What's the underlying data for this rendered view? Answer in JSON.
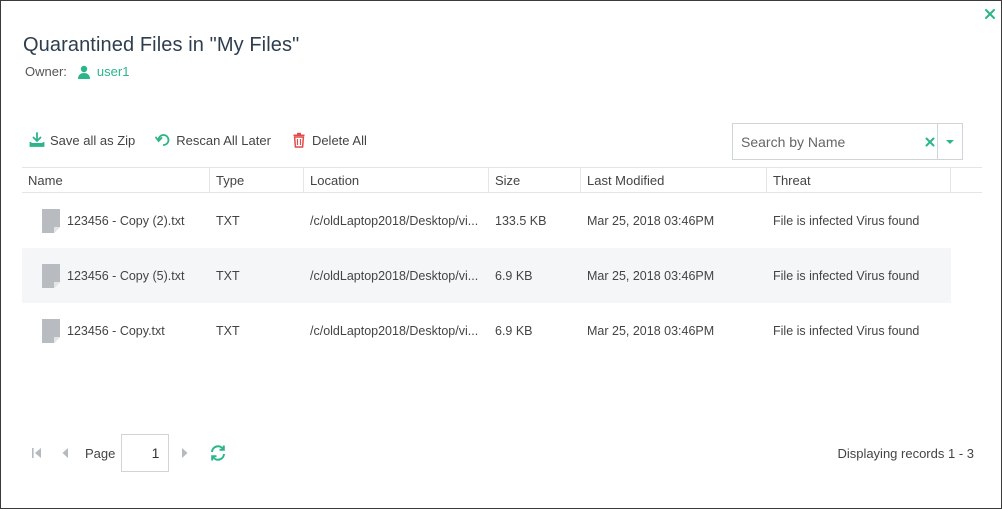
{
  "dialog": {
    "title": "Quarantined Files in \"My Files\"",
    "owner_label": "Owner:",
    "owner_name": "user1",
    "accent_color": "#2bb58a"
  },
  "toolbar": {
    "save_zip_label": "Save all as Zip",
    "rescan_label": "Rescan All Later",
    "delete_label": "Delete All"
  },
  "search": {
    "placeholder": "Search by Name",
    "value": ""
  },
  "table": {
    "columns": [
      "Name",
      "Type",
      "Location",
      "Size",
      "Last Modified",
      "Threat"
    ],
    "rows": [
      {
        "name": "123456 - Copy (2).txt",
        "type": "TXT",
        "location": "/c/oldLaptop2018/Desktop/vi...",
        "size": "133.5 KB",
        "modified": "Mar 25, 2018 03:46PM",
        "threat": "File is infected Virus found"
      },
      {
        "name": "123456 - Copy (5).txt",
        "type": "TXT",
        "location": "/c/oldLaptop2018/Desktop/vi...",
        "size": "6.9 KB",
        "modified": "Mar 25, 2018 03:46PM",
        "threat": "File is infected Virus found"
      },
      {
        "name": "123456 - Copy.txt",
        "type": "TXT",
        "location": "/c/oldLaptop2018/Desktop/vi...",
        "size": "6.9 KB",
        "modified": "Mar 25, 2018 03:46PM",
        "threat": "File is infected Virus found"
      }
    ]
  },
  "pager": {
    "page_label": "Page",
    "page_value": "1",
    "records_text": "Displaying records 1 - 3"
  }
}
